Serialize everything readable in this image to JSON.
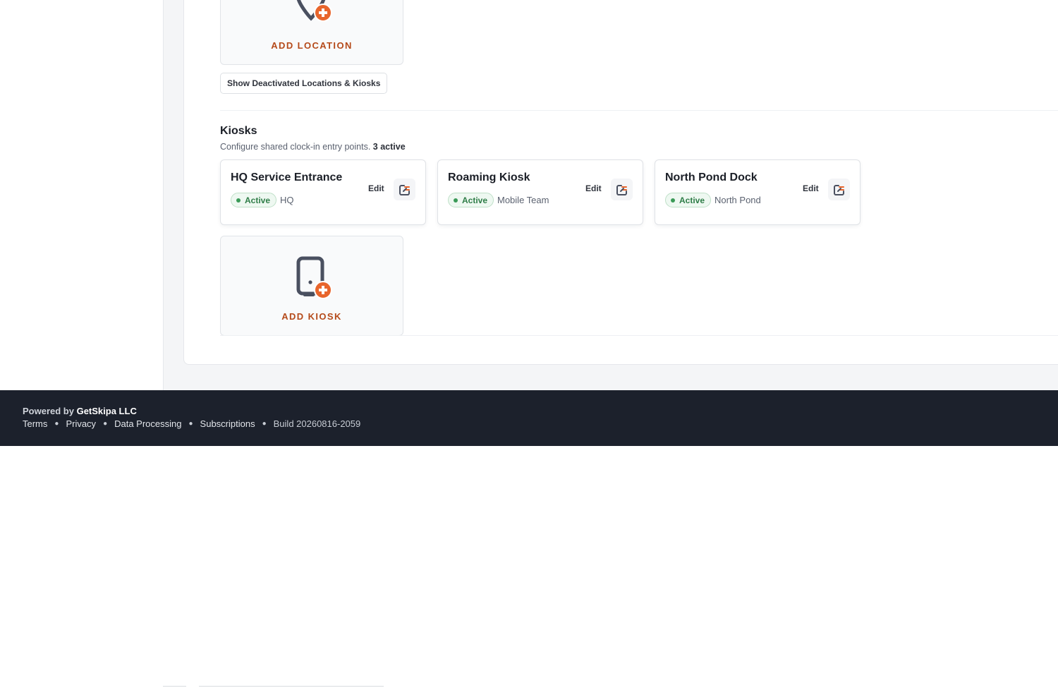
{
  "locations": {
    "add_label": "ADD LOCATION",
    "show_deactivated_label": "Show Deactivated Locations & Kiosks"
  },
  "kiosks": {
    "title": "Kiosks",
    "subtitle": "Configure shared clock-in entry points.",
    "active_count": "3 active",
    "edit_label": "Edit",
    "items": [
      {
        "name": "HQ Service Entrance",
        "status": "Active",
        "location": "HQ"
      },
      {
        "name": "Roaming Kiosk",
        "status": "Active",
        "location": "Mobile Team"
      },
      {
        "name": "North Pond Dock",
        "status": "Active",
        "location": "North Pond"
      }
    ],
    "add_label": "ADD KIOSK"
  },
  "footer": {
    "powered_prefix": "Powered by",
    "company": "GetSkipa LLC",
    "links": [
      "Terms",
      "Privacy",
      "Data Processing",
      "Subscriptions"
    ],
    "build": "Build 20260816-2059"
  },
  "colors": {
    "accent": "#e8652c",
    "accent_text": "#b54a1a",
    "active_green": "#2e7d47",
    "footer_bg": "#1c212c"
  },
  "icons": {
    "add_location": "map-pin-plus-icon",
    "add_kiosk": "tablet-plus-icon",
    "open": "external-open-icon",
    "status_dot": "status-dot-icon"
  }
}
